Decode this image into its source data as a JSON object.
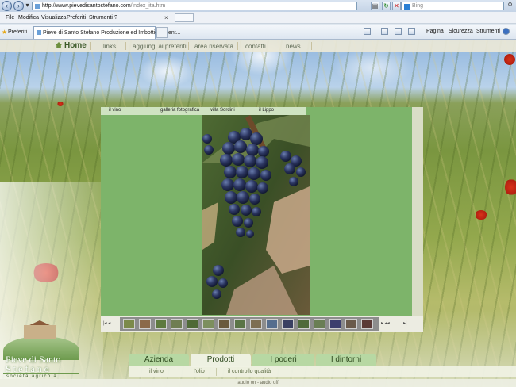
{
  "browser": {
    "url_host": "http://www.pievedisantostefano.com",
    "url_path": "/index_ita.htm",
    "search_placeholder": "Bing",
    "menu": [
      "File",
      "Modifica",
      "Visualizza",
      "Preferiti",
      "Strumenti",
      "?"
    ],
    "favorites_label": "Preferiti",
    "tab_title": "Pieve di Santo Stefano Produzione ed Imbottigliament...",
    "commands": [
      "Pagina",
      "Sicurezza",
      "Strumenti"
    ]
  },
  "site_nav": {
    "home": "Home",
    "links": [
      "links",
      "aggiungi ai preferiti",
      "area riservata",
      "contatti",
      "news"
    ]
  },
  "gallery": {
    "tabs": [
      "il vino",
      "galleria fotografica",
      "villa Sordini",
      "il Lippo"
    ],
    "counter_left": "|◂ ◂",
    "counter_right": "▸ ◂◂",
    "end_mark": "▸|"
  },
  "logo": {
    "line1": "Pieve di Santo",
    "line2": "Stefano",
    "subtitle": "società agricola"
  },
  "bottom_tabs": [
    "Azienda",
    "Prodotti",
    "I poderi",
    "I dintorni"
  ],
  "active_tab": "Prodotti",
  "sub_nav": [
    "il vino",
    "l'olio",
    "il controllo qualità"
  ],
  "audio": "audio on - audio off"
}
